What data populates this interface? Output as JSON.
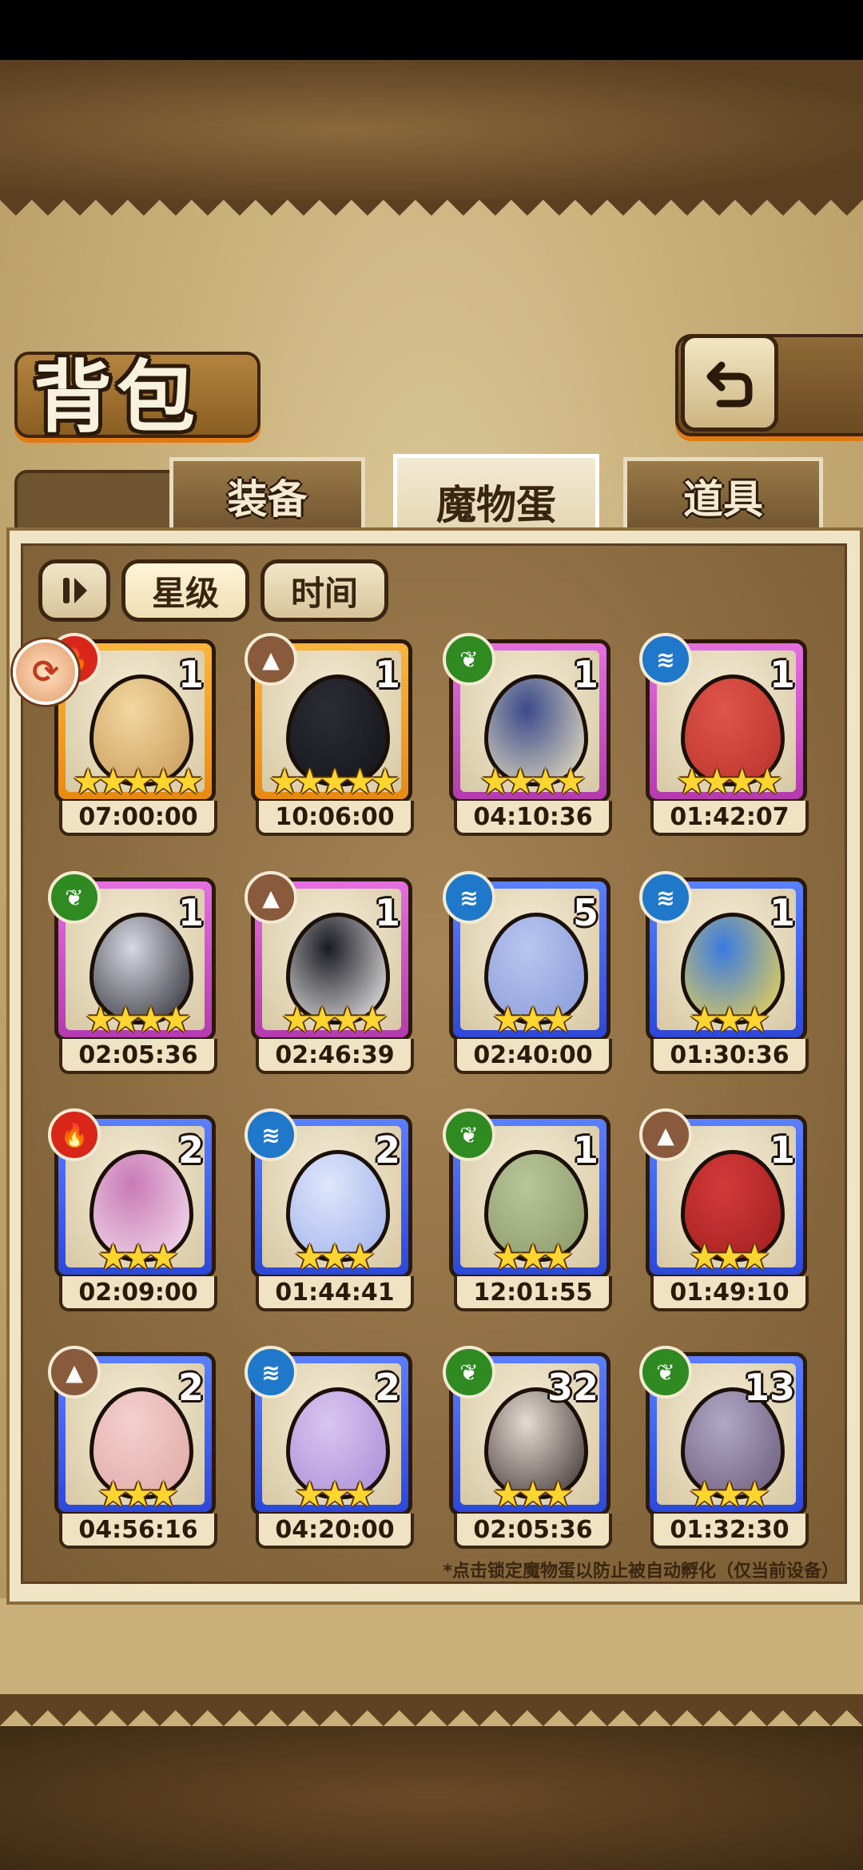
{
  "header": {
    "title": "背包"
  },
  "tabs": [
    {
      "label": "装备",
      "active": false
    },
    {
      "label": "魔物蛋",
      "active": true
    },
    {
      "label": "道具",
      "active": false
    }
  ],
  "sort_buttons": [
    {
      "label": "星级",
      "selected": true
    },
    {
      "label": "时间",
      "selected": false
    }
  ],
  "eggs": [
    {
      "element": "fire",
      "count": "1",
      "stars": 5,
      "frame": "gold",
      "timer": "07:00:00",
      "locked": true
    },
    {
      "element": "earth",
      "count": "1",
      "stars": 5,
      "frame": "gold",
      "timer": "10:06:00"
    },
    {
      "element": "grass",
      "count": "1",
      "stars": 4,
      "frame": "purple",
      "timer": "04:10:36"
    },
    {
      "element": "water",
      "count": "1",
      "stars": 4,
      "frame": "purple",
      "timer": "01:42:07"
    },
    {
      "element": "grass",
      "count": "1",
      "stars": 4,
      "frame": "purple",
      "timer": "02:05:36"
    },
    {
      "element": "earth",
      "count": "1",
      "stars": 4,
      "frame": "purple",
      "timer": "02:46:39"
    },
    {
      "element": "water",
      "count": "5",
      "stars": 3,
      "frame": "blue",
      "timer": "02:40:00"
    },
    {
      "element": "water",
      "count": "1",
      "stars": 3,
      "frame": "blue",
      "timer": "01:30:36"
    },
    {
      "element": "fire",
      "count": "2",
      "stars": 3,
      "frame": "blue",
      "timer": "02:09:00"
    },
    {
      "element": "water",
      "count": "2",
      "stars": 3,
      "frame": "blue",
      "timer": "01:44:41"
    },
    {
      "element": "grass",
      "count": "1",
      "stars": 3,
      "frame": "blue",
      "timer": "12:01:55"
    },
    {
      "element": "earth",
      "count": "1",
      "stars": 3,
      "frame": "blue",
      "timer": "01:49:10"
    },
    {
      "element": "earth",
      "count": "2",
      "stars": 3,
      "frame": "blue",
      "timer": "04:56:16"
    },
    {
      "element": "water",
      "count": "2",
      "stars": 3,
      "frame": "blue",
      "timer": "04:20:00"
    },
    {
      "element": "grass",
      "count": "32",
      "stars": 3,
      "frame": "blue",
      "timer": "02:05:36"
    },
    {
      "element": "grass",
      "count": "13",
      "stars": 3,
      "frame": "blue",
      "timer": "01:32:30"
    }
  ],
  "footnote": "*点击锁定魔物蛋以防止被自动孵化（仅当前设备）",
  "icons": {
    "back": "return-arrow-icon",
    "sort_toggle": "sort-toggle-icon",
    "lock": "lock-icon"
  },
  "colors": {
    "frame_gold": "#ffb43a",
    "frame_purple": "#e56ee0",
    "frame_blue": "#5a7fff",
    "fire": "#d8261b",
    "earth": "#8a5a3c",
    "grass": "#2f8a22",
    "water": "#1f78c9"
  }
}
